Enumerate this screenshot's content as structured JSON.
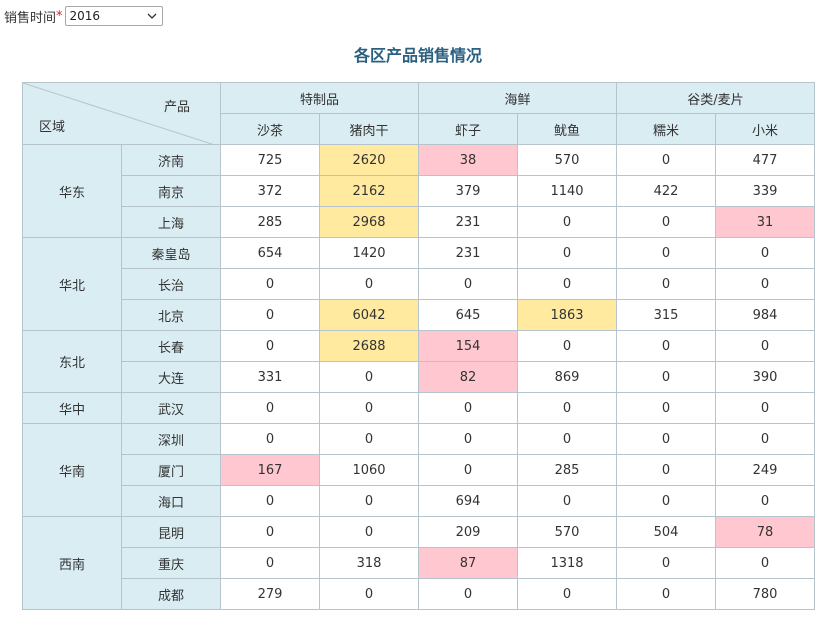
{
  "filter": {
    "label": "销售时间",
    "required_mark": "*",
    "year": "2016"
  },
  "title": "各区产品销售情况",
  "header": {
    "product_label": "产品",
    "region_label": "区域",
    "groups": [
      "特制品",
      "海鲜",
      "谷类/麦片"
    ],
    "products": [
      "沙茶",
      "猪肉干",
      "虾子",
      "鱿鱼",
      "糯米",
      "小米"
    ]
  },
  "rows": [
    {
      "region": "华东",
      "city": "济南",
      "values": [
        "725",
        "2620",
        "38",
        "570",
        "0",
        "477"
      ]
    },
    {
      "region": "华东",
      "city": "南京",
      "values": [
        "372",
        "2162",
        "379",
        "1140",
        "422",
        "339"
      ]
    },
    {
      "region": "华东",
      "city": "上海",
      "values": [
        "285",
        "2968",
        "231",
        "0",
        "0",
        "31"
      ]
    },
    {
      "region": "华北",
      "city": "秦皇岛",
      "values": [
        "654",
        "1420",
        "231",
        "0",
        "0",
        "0"
      ]
    },
    {
      "region": "华北",
      "city": "长治",
      "values": [
        "0",
        "0",
        "0",
        "0",
        "0",
        "0"
      ]
    },
    {
      "region": "华北",
      "city": "北京",
      "values": [
        "0",
        "6042",
        "645",
        "1863",
        "315",
        "984"
      ]
    },
    {
      "region": "东北",
      "city": "长春",
      "values": [
        "0",
        "2688",
        "154",
        "0",
        "0",
        "0"
      ]
    },
    {
      "region": "东北",
      "city": "大连",
      "values": [
        "331",
        "0",
        "82",
        "869",
        "0",
        "390"
      ]
    },
    {
      "region": "华中",
      "city": "武汉",
      "values": [
        "0",
        "0",
        "0",
        "0",
        "0",
        "0"
      ]
    },
    {
      "region": "华南",
      "city": "深圳",
      "values": [
        "0",
        "0",
        "0",
        "0",
        "0",
        "0"
      ]
    },
    {
      "region": "华南",
      "city": "厦门",
      "values": [
        "167",
        "1060",
        "0",
        "285",
        "0",
        "249"
      ]
    },
    {
      "region": "华南",
      "city": "海口",
      "values": [
        "0",
        "0",
        "694",
        "0",
        "0",
        "0"
      ]
    },
    {
      "region": "西南",
      "city": "昆明",
      "values": [
        "0",
        "0",
        "209",
        "570",
        "504",
        "78"
      ]
    },
    {
      "region": "西南",
      "city": "重庆",
      "values": [
        "0",
        "318",
        "87",
        "1318",
        "0",
        "0"
      ]
    },
    {
      "region": "西南",
      "city": "成都",
      "values": [
        "279",
        "0",
        "0",
        "0",
        "0",
        "780"
      ]
    }
  ],
  "colors": {
    "header_bg": "#daedf3",
    "high_value": "#ffeaa0",
    "low_value": "#ffc7cf",
    "title": "#2b6080"
  }
}
